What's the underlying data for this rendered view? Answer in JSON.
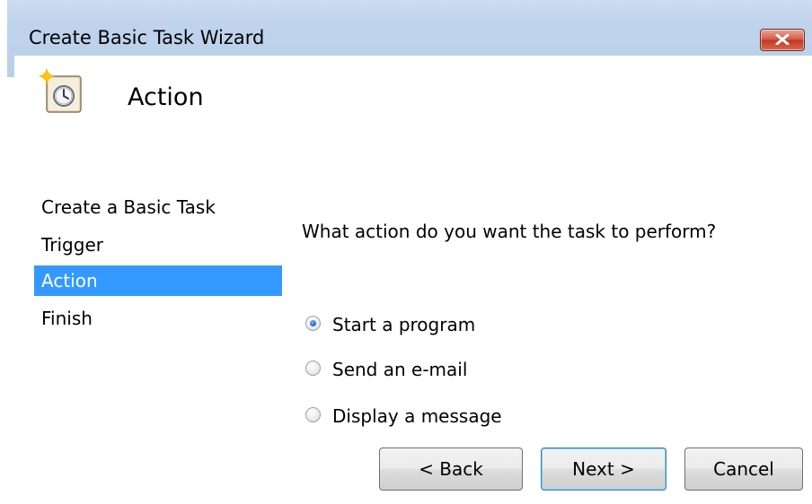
{
  "window": {
    "title": "Create Basic Task Wizard",
    "close_icon": "close-icon"
  },
  "header": {
    "title": "Action",
    "icon": "task-scheduler-icon"
  },
  "steps": [
    {
      "label": "Create a Basic Task",
      "active": false
    },
    {
      "label": "Trigger",
      "active": false
    },
    {
      "label": "Action",
      "active": true
    },
    {
      "label": "Finish",
      "active": false
    }
  ],
  "main": {
    "question": "What action do you want the task to perform?",
    "options": [
      {
        "label": "Start a program",
        "checked": true
      },
      {
        "label": "Send an e-mail",
        "checked": false
      },
      {
        "label": "Display a message",
        "checked": false
      }
    ]
  },
  "buttons": {
    "back": "< Back",
    "next": "Next >",
    "cancel": "Cancel"
  },
  "colors": {
    "selection": "#3399ff",
    "titlebar": "#c0d3ec",
    "close": "#c0361f"
  }
}
